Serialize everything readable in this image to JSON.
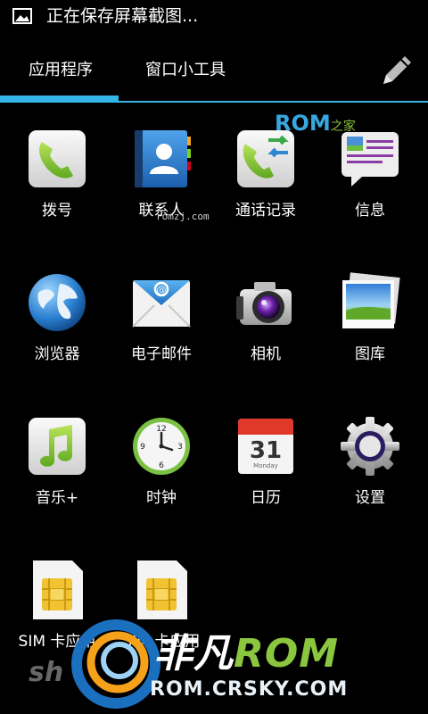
{
  "status_bar": {
    "notification_icon": "image-icon",
    "text": "正在保存屏幕截图..."
  },
  "tabs": {
    "apps_label": "应用程序",
    "widgets_label": "窗口小工具",
    "edit_icon": "pencil-icon",
    "accent": "#33b5e5"
  },
  "apps": [
    {
      "label": "拨号",
      "icon": "phone-icon"
    },
    {
      "label": "联系人",
      "icon": "contacts-icon"
    },
    {
      "label": "通话记录",
      "icon": "call-log-icon"
    },
    {
      "label": "信息",
      "icon": "messaging-icon"
    },
    {
      "label": "浏览器",
      "icon": "globe-icon"
    },
    {
      "label": "电子邮件",
      "icon": "email-icon"
    },
    {
      "label": "相机",
      "icon": "camera-icon"
    },
    {
      "label": "图库",
      "icon": "gallery-icon"
    },
    {
      "label": "音乐+",
      "icon": "music-icon"
    },
    {
      "label": "时钟",
      "icon": "clock-icon"
    },
    {
      "label": "日历",
      "icon": "calendar-icon"
    },
    {
      "label": "设置",
      "icon": "gear-icon"
    },
    {
      "label": "SIM 卡应用",
      "icon": "sim-card-icon"
    },
    {
      "label": "SIM 卡应用",
      "icon": "sim-card-icon"
    }
  ],
  "calendar_icon_text": {
    "day": "31",
    "weekday": "Monday"
  },
  "clock_icon_text": {
    "twelve": "12",
    "three": "3",
    "six": "6",
    "nine": "9"
  },
  "watermarks": {
    "rom_brand": "ROM",
    "rom_brand_suffix": "之家",
    "rom_url": "romzj.com",
    "crsky_brand": "非凡",
    "crsky_brand_rom": "ROM",
    "crsky_url": "ROM.CRSKY.COM",
    "faint": "sh"
  }
}
